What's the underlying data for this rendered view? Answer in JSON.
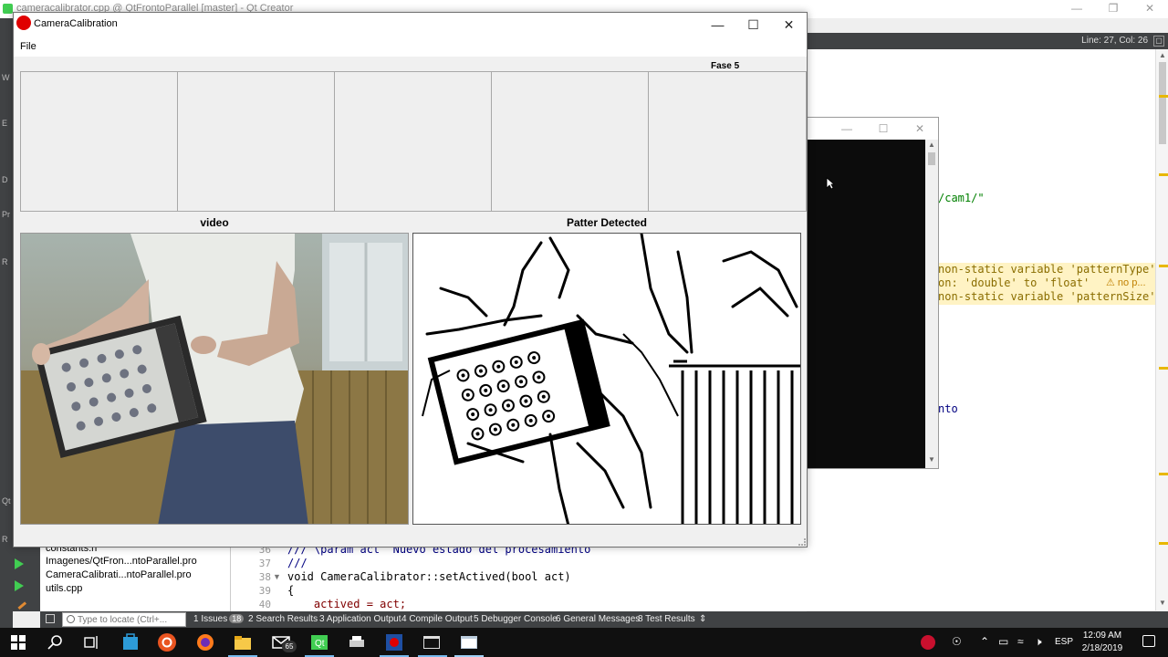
{
  "qt_creator": {
    "title": "cameracalibrator.cpp @ QtFrontoParallel [master] - Qt Creator",
    "line_col": "Line: 27, Col: 26",
    "editor_lines": [
      "/cam1/\"",
      "non-static variable 'patternType'",
      "on: 'double' to 'float'",
      "non-static variable 'patternSize'",
      "nto"
    ],
    "warning_hint": "⚠ no p...",
    "project_files": [
      "constants.h",
      "Imagenes/QtFron...ntoParallel.pro",
      "CameraCalibrati...ntoParallel.pro",
      "utils.cpp"
    ],
    "code": {
      "line_numbers": [
        "36",
        "37",
        "38",
        "39",
        "40"
      ],
      "lines": [
        "/// \\param act  Nuevo estado del procesamiento",
        "///",
        "void CameraCalibrator::setActived(bool act)",
        "{",
        "    actived = act;"
      ]
    },
    "mode_letters": [
      "W",
      "E",
      "D",
      "Pr",
      "R",
      "Qt",
      "R"
    ],
    "locator_placeholder": "Type to locate (Ctrl+...",
    "output_tabs": [
      {
        "label": "1 Issues",
        "badge": "18"
      },
      {
        "label": "2 Search Results"
      },
      {
        "label": "3 Application Output"
      },
      {
        "label": "4 Compile Output"
      },
      {
        "label": "5 Debugger Console"
      },
      {
        "label": "6 General Messages"
      },
      {
        "label": "8 Test Results"
      }
    ],
    "output_arrows": "⇕"
  },
  "app": {
    "title": "CameraCalibration",
    "menu": [
      "File"
    ],
    "fase_label": "Fase 5",
    "thumb_count": 5,
    "video_label": "video",
    "pattern_label": "Patter Detected"
  },
  "taskbar": {
    "search_placeholder": "",
    "mail_badge": "65",
    "language": "ESP",
    "time": "12:09 AM",
    "date": "2/18/2019"
  },
  "colors": {
    "accent": "#76b9ed",
    "app_icon": "#e00000",
    "qt_green": "#41cd52"
  }
}
